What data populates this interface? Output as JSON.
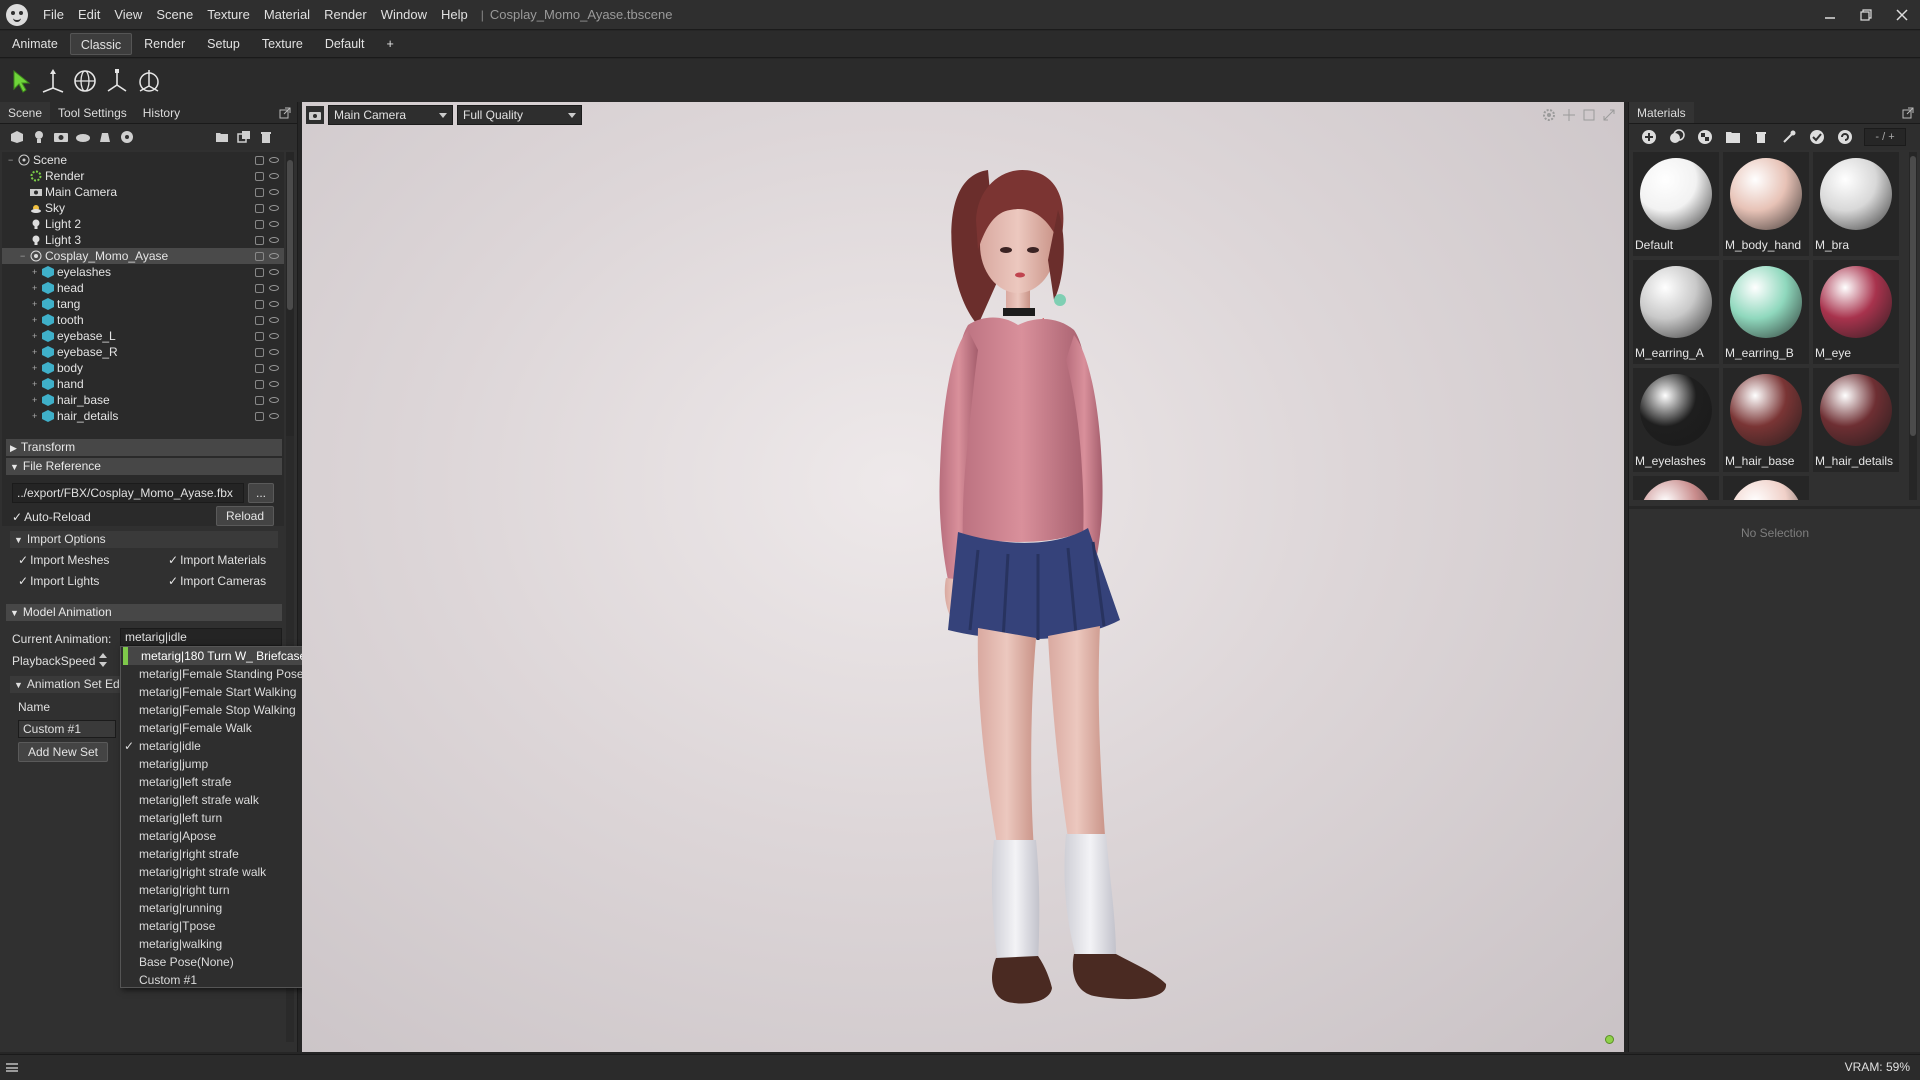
{
  "app": {
    "menu": [
      "File",
      "Edit",
      "View",
      "Scene",
      "Texture",
      "Material",
      "Render",
      "Window",
      "Help"
    ],
    "title_separator": "|",
    "document_title": "Cosplay_Momo_Ayase.tbscene",
    "window_controls": [
      "minimize",
      "restore",
      "close"
    ]
  },
  "workspace_tabs": [
    "Animate",
    "Classic",
    "Render",
    "Setup",
    "Texture",
    "Default",
    "+"
  ],
  "active_workspace": "Classic",
  "toolbar_tools": [
    "select-arrow-icon",
    "move-icon",
    "rotate-icon",
    "scale-icon",
    "transform-all-icon"
  ],
  "left_panel": {
    "tabs": [
      "Scene",
      "Tool Settings",
      "History"
    ],
    "active_tab": "Scene",
    "scene_tree": [
      {
        "label": "Scene",
        "indent": 0,
        "icon": "scene-icon"
      },
      {
        "label": "Render",
        "indent": 1,
        "icon": "render-gear-icon"
      },
      {
        "label": "Main Camera",
        "indent": 1,
        "icon": "camera-icon"
      },
      {
        "label": "Sky",
        "indent": 1,
        "icon": "sky-icon"
      },
      {
        "label": "Light 2",
        "indent": 1,
        "icon": "light-icon"
      },
      {
        "label": "Light 3",
        "indent": 1,
        "icon": "light-icon"
      },
      {
        "label": "Cosplay_Momo_Ayase",
        "indent": 1,
        "icon": "model-icon",
        "selected": true
      },
      {
        "label": "eyelashes",
        "indent": 2,
        "icon": "mesh-icon"
      },
      {
        "label": "head",
        "indent": 2,
        "icon": "mesh-icon"
      },
      {
        "label": "tang",
        "indent": 2,
        "icon": "mesh-icon"
      },
      {
        "label": "tooth",
        "indent": 2,
        "icon": "mesh-icon"
      },
      {
        "label": "eyebase_L",
        "indent": 2,
        "icon": "mesh-icon"
      },
      {
        "label": "eyebase_R",
        "indent": 2,
        "icon": "mesh-icon"
      },
      {
        "label": "body",
        "indent": 2,
        "icon": "mesh-icon"
      },
      {
        "label": "hand",
        "indent": 2,
        "icon": "mesh-icon"
      },
      {
        "label": "hair_base",
        "indent": 2,
        "icon": "mesh-icon"
      },
      {
        "label": "hair_details",
        "indent": 2,
        "icon": "mesh-icon"
      }
    ],
    "sections": {
      "transform": "Transform",
      "file_reference": "File Reference",
      "file_path": "../export/FBX/Cosplay_Momo_Ayase.fbx",
      "browse_label": "...",
      "auto_reload": "Auto-Reload",
      "reload_label": "Reload",
      "import_options": "Import Options",
      "import_meshes": "Import Meshes",
      "import_materials": "Import Materials",
      "import_lights": "Import Lights",
      "import_cameras": "Import Cameras",
      "model_animation": "Model Animation",
      "current_animation_label": "Current Animation:",
      "current_animation_value": "metarig|idle",
      "playback_speed_label": "PlaybackSpeed",
      "animation_set_label": "Animation Set Ed",
      "name_label": "Name",
      "name_value": "Custom #1",
      "add_new_set": "Add New Set"
    }
  },
  "animation_dropdown": {
    "items": [
      "metarig|180 Turn W_ Briefcase",
      "metarig|Female Standing Pose",
      "metarig|Female Start Walking",
      "metarig|Female Stop Walking",
      "metarig|Female Walk",
      "metarig|idle",
      "metarig|jump",
      "metarig|left strafe",
      "metarig|left strafe walk",
      "metarig|left turn",
      "metarig|Apose",
      "metarig|right strafe",
      "metarig|right strafe walk",
      "metarig|right turn",
      "metarig|running",
      "metarig|Tpose",
      "metarig|walking",
      "Base Pose(None)",
      "Custom #1"
    ],
    "highlighted": "metarig|180 Turn W_ Briefcase",
    "checked": "metarig|idle",
    "check_mark": "✓"
  },
  "viewport": {
    "camera": "Main Camera",
    "quality": "Full Quality",
    "status_color": "#8fd14a"
  },
  "right_panel": {
    "title": "Materials",
    "count_display": "- / +",
    "materials": [
      {
        "name": "Default",
        "color": "#f2f2f2"
      },
      {
        "name": "M_body_hand",
        "color": "#e7c2b6"
      },
      {
        "name": "M_bra",
        "color": "#d8d8d8"
      },
      {
        "name": "M_earring_A",
        "color": "#c9c9c9"
      },
      {
        "name": "M_earring_B",
        "color": "#8fd8bd"
      },
      {
        "name": "M_eye",
        "color": "#a8334d"
      },
      {
        "name": "M_eyelashes",
        "color": "#1e1e1e"
      },
      {
        "name": "M_hair_base",
        "color": "#7a3535"
      },
      {
        "name": "M_hair_details",
        "color": "#6e2f33"
      }
    ],
    "no_selection": "No Selection"
  },
  "status_bar": {
    "vram": "VRAM: 59%"
  }
}
